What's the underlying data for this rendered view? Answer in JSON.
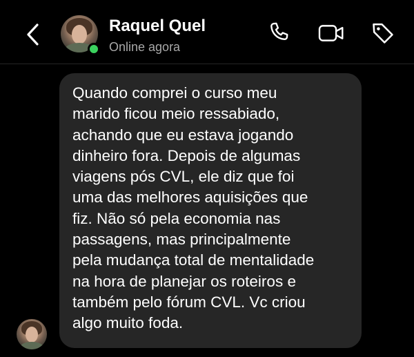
{
  "header": {
    "contact_name": "Raquel Quel",
    "status": "Online agora",
    "online_color": "#3bd15e",
    "icons": {
      "back": "chevron-left-icon",
      "call": "phone-icon",
      "video": "video-camera-icon",
      "tag": "tag-icon"
    }
  },
  "message": {
    "sender": "Raquel Quel",
    "text": "Quando comprei o curso meu\nmarido ficou meio ressabiado,\nachando que eu estava jogando\ndinheiro fora. Depois de algumas\nviagens pós CVL, ele diz que foi\numa das melhores aquisições que\nfiz. Não só pela economia nas\npassagens, mas principalmente\npela mudança total de mentalidade\nna hora de planejar os roteiros e\ntambém pelo fórum CVL.    Vc criou\nalgo muito foda."
  }
}
